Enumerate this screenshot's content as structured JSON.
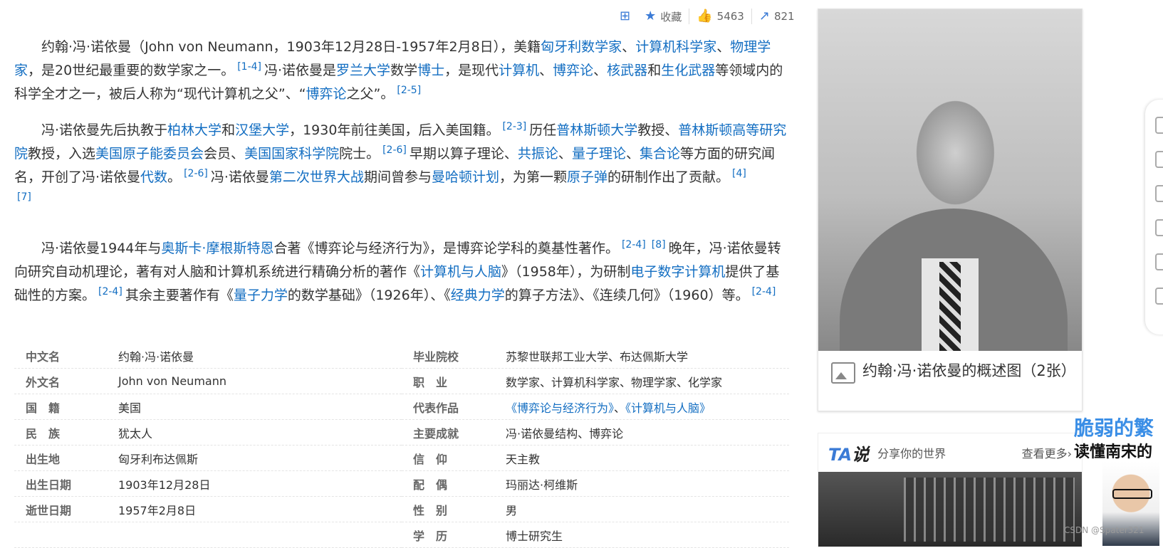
{
  "toolbar": {
    "add_icon": "plus-square-icon",
    "collect_label": "收藏",
    "like_count": "5463",
    "share_count": "821"
  },
  "paragraphs": {
    "p1": {
      "t1": "约翰·冯·诺依曼（John von Neumann，1903年12月28日-1957年2月8日），美籍",
      "l1": "匈牙利数学家",
      "s1": "、",
      "l2": "计算机科学家",
      "s2": "、",
      "l3": "物理学家",
      "t2": "，是20世纪最重要的数学家之一。",
      "r1": "[1-4]",
      "t3": "冯·诺依曼是",
      "l4": "罗兰大学",
      "t4": "数学",
      "l5": "博士",
      "t5": "，是现代",
      "l6": "计算机",
      "s3": "、",
      "l7": "博弈论",
      "s4": "、",
      "l8": "核武器",
      "t6": "和",
      "l9": "生化武器",
      "t7": "等领域内的科学全才之一，被后人称为“现代计算机之父”、“",
      "l10": "博弈论",
      "t8": "之父”。",
      "r2": "[2-5]"
    },
    "p2": {
      "t1": "冯·诺依曼先后执教于",
      "l1": "柏林大学",
      "t2": "和",
      "l2": "汉堡大学",
      "t3": "，1930年前往美国，后入美国籍。",
      "r1": "[2-3]",
      "t4": "历任",
      "l3": "普林斯顿大学",
      "t5": "教授、",
      "l4": "普林斯顿高等研究院",
      "t6": "教授，入选",
      "l5": "美国原子能委员会",
      "t7": "会员、",
      "l6": "美国国家科学院",
      "t8": "院士。",
      "r2": "[2-6]",
      "t9": "早期以算子理论、",
      "l7": "共振论",
      "s1": "、",
      "l8": "量子理论",
      "s2": "、",
      "l9": "集合论",
      "t10": "等方面的研究闻名，开创了冯·诺依曼",
      "l10": "代数",
      "t11": "。",
      "r3": "[2-6]",
      "t12": "冯·诺依曼",
      "l11": "第二次世界大战",
      "t13": "期间曾参与",
      "l12": "曼哈顿计划",
      "t14": "，为第一颗",
      "l13": "原子弹",
      "t15": "的研制作出了贡献。",
      "r4": "[4]",
      "r5": "[7]"
    },
    "p3": {
      "t1": "冯·诺依曼1944年与",
      "l1": "奥斯卡·摩根斯特恩",
      "t2": "合著《博弈论与经济行为》，是博弈论学科的奠基性著作。",
      "r1": "[2-4]",
      "r2": "[8]",
      "t3": "晚年，冯·诺依曼转向研究自动机理论，著有对人脑和计算机系统进行精确分析的著作《",
      "l2": "计算机与人脑",
      "t4": "》（1958年），为研制",
      "l3": "电子数字计算机",
      "t5": "提供了基础性的方案。",
      "r3": "[2-4]",
      "t6": "其余主要著作有《",
      "l4": "量子力学",
      "t7": "的数学基础》（1926年）、《",
      "l5": "经典力学",
      "t8": "的算子方法》、《连续几何》（1960）等。",
      "r4": "[2-4]"
    }
  },
  "infobox": {
    "left": [
      {
        "k": "中文名",
        "v": "约翰·冯·诺依曼",
        "link": false
      },
      {
        "k": "外文名",
        "v": "John von Neumann",
        "link": false
      },
      {
        "k": "国　籍",
        "v": "美国",
        "link": true
      },
      {
        "k": "民　族",
        "v": "犹太人",
        "link": true
      },
      {
        "k": "出生地",
        "v": "匈牙利布达佩斯",
        "link": false
      },
      {
        "k": "出生日期",
        "v": "1903年12月28日",
        "link": false
      },
      {
        "k": "逝世日期",
        "v": "1957年2月8日",
        "link": false
      }
    ],
    "right": [
      {
        "k": "毕业院校",
        "v": "苏黎世联邦工业大学、布达佩斯大学"
      },
      {
        "k": "职　业",
        "v": "数学家、计算机科学家、物理学家、化学家"
      },
      {
        "k": "代表作品",
        "v1": "《博弈论与经济行为》",
        "sep": "、",
        "v2": "《计算机与人脑》"
      },
      {
        "k": "主要成就",
        "v": "冯·诺依曼结构、博弈论"
      },
      {
        "k": "信　仰",
        "v": "天主教"
      },
      {
        "k": "配　偶",
        "v": "玛丽达·柯维斯"
      },
      {
        "k": "性　别",
        "v": "男"
      },
      {
        "k": "学　历",
        "v": "博士研究生"
      }
    ]
  },
  "card": {
    "caption": "约翰·冯·诺依曼的概述图（2张）"
  },
  "ta": {
    "logo_a": "TA",
    "logo_b": "说",
    "slogan": "分享你的世界",
    "more": "查看更多›"
  },
  "ad": {
    "title": "脆弱的繁",
    "subtitle": "读懂南宋的"
  },
  "watermark": "CSDN @Spater321"
}
